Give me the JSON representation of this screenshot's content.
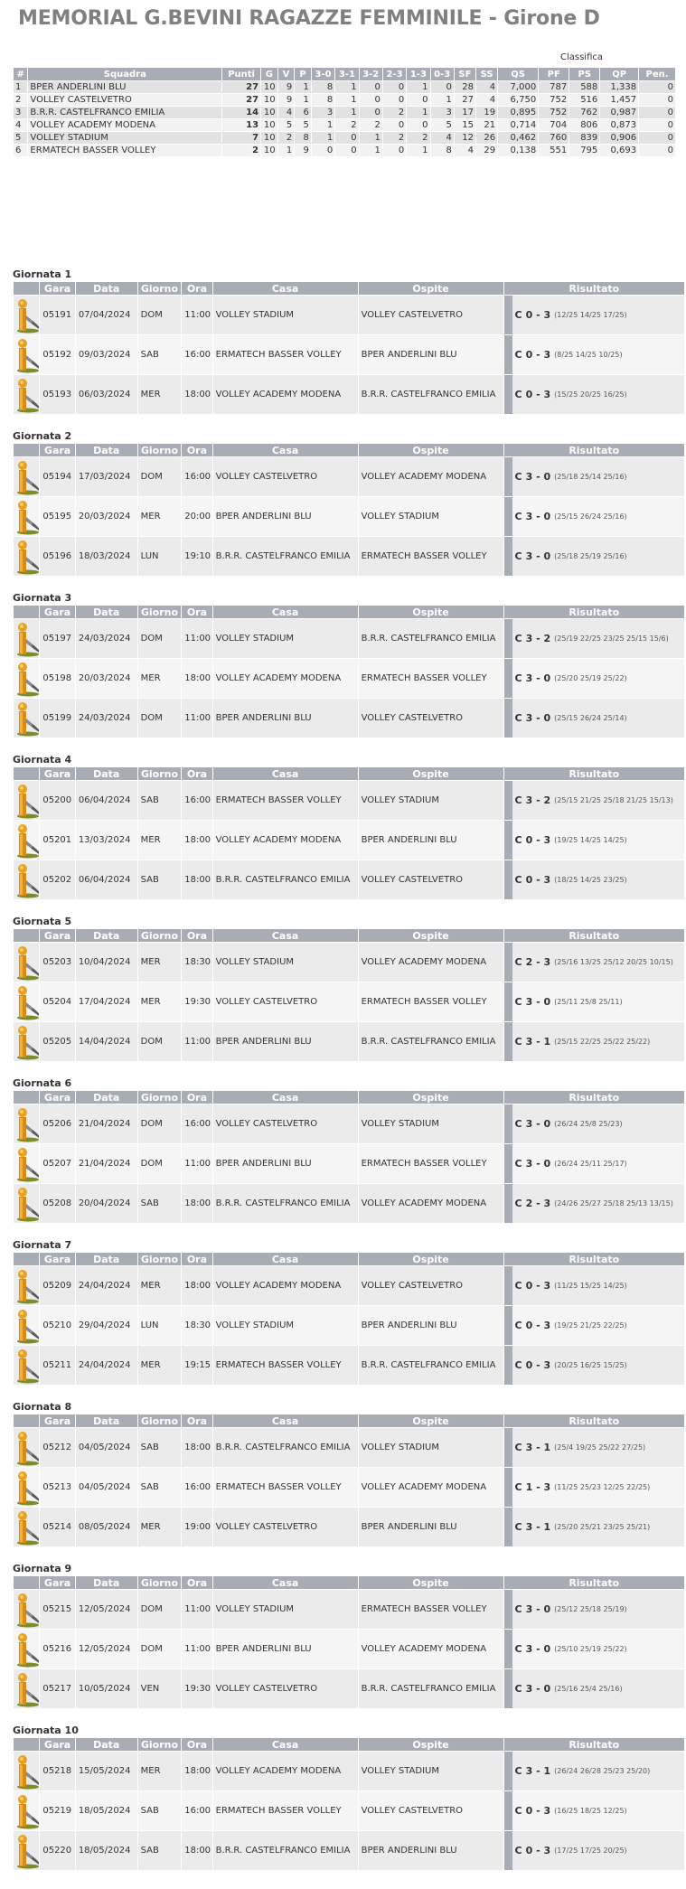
{
  "page": {
    "title": "MEMORIAL G.BEVINI RAGAZZE FEMMINILE - Girone D",
    "classifica_label": "Classifica"
  },
  "standings": {
    "headers": [
      "#",
      "Squadra",
      "Punti",
      "G",
      "V",
      "P",
      "3-0",
      "3-1",
      "3-2",
      "2-3",
      "1-3",
      "0-3",
      "SF",
      "SS",
      "QS",
      "PF",
      "PS",
      "QP",
      "Pen."
    ],
    "rows": [
      [
        "1",
        "BPER ANDERLINI BLU",
        "27",
        "10",
        "9",
        "1",
        "8",
        "1",
        "0",
        "0",
        "1",
        "0",
        "28",
        "4",
        "7,000",
        "787",
        "588",
        "1,338",
        "0"
      ],
      [
        "2",
        "VOLLEY CASTELVETRO",
        "27",
        "10",
        "9",
        "1",
        "8",
        "1",
        "0",
        "0",
        "0",
        "1",
        "27",
        "4",
        "6,750",
        "752",
        "516",
        "1,457",
        "0"
      ],
      [
        "3",
        "B.R.R. CASTELFRANCO EMILIA",
        "14",
        "10",
        "4",
        "6",
        "3",
        "1",
        "0",
        "2",
        "1",
        "3",
        "17",
        "19",
        "0,895",
        "752",
        "762",
        "0,987",
        "0"
      ],
      [
        "4",
        "VOLLEY ACADEMY MODENA",
        "13",
        "10",
        "5",
        "5",
        "1",
        "2",
        "2",
        "0",
        "0",
        "5",
        "15",
        "21",
        "0,714",
        "704",
        "806",
        "0,873",
        "0"
      ],
      [
        "5",
        "VOLLEY STADIUM",
        "7",
        "10",
        "2",
        "8",
        "1",
        "0",
        "1",
        "2",
        "2",
        "4",
        "12",
        "26",
        "0,462",
        "760",
        "839",
        "0,906",
        "0"
      ],
      [
        "6",
        "ERMATECH BASSER VOLLEY",
        "2",
        "10",
        "1",
        "9",
        "0",
        "0",
        "1",
        "0",
        "1",
        "8",
        "4",
        "29",
        "0,138",
        "551",
        "795",
        "0,693",
        "0"
      ]
    ]
  },
  "match_headers": [
    "",
    "Gara",
    "Data",
    "Giorno",
    "Ora",
    "Casa",
    "Ospite",
    "Risultato"
  ],
  "rounds": [
    {
      "title": "Giornata 1",
      "matches": [
        {
          "gara": "05191",
          "data": "07/04/2024",
          "giorno": "DOM",
          "ora": "11:00",
          "casa": "VOLLEY STADIUM",
          "ospite": "VOLLEY CASTELVETRO",
          "c": "C",
          "score": "0 - 3",
          "sets": "(12/25 14/25 17/25)"
        },
        {
          "gara": "05192",
          "data": "09/03/2024",
          "giorno": "SAB",
          "ora": "16:00",
          "casa": "ERMATECH BASSER VOLLEY",
          "ospite": "BPER ANDERLINI BLU",
          "c": "C",
          "score": "0 - 3",
          "sets": "(8/25 14/25 10/25)"
        },
        {
          "gara": "05193",
          "data": "06/03/2024",
          "giorno": "MER",
          "ora": "18:00",
          "casa": "VOLLEY ACADEMY MODENA",
          "ospite": "B.R.R. CASTELFRANCO EMILIA",
          "c": "C",
          "score": "0 - 3",
          "sets": "(15/25 20/25 16/25)"
        }
      ]
    },
    {
      "title": "Giornata 2",
      "matches": [
        {
          "gara": "05194",
          "data": "17/03/2024",
          "giorno": "DOM",
          "ora": "16:00",
          "casa": "VOLLEY CASTELVETRO",
          "ospite": "VOLLEY ACADEMY MODENA",
          "c": "C",
          "score": "3 - 0",
          "sets": "(25/18 25/14 25/16)"
        },
        {
          "gara": "05195",
          "data": "20/03/2024",
          "giorno": "MER",
          "ora": "20:00",
          "casa": "BPER ANDERLINI BLU",
          "ospite": "VOLLEY STADIUM",
          "c": "C",
          "score": "3 - 0",
          "sets": "(25/15 26/24 25/16)"
        },
        {
          "gara": "05196",
          "data": "18/03/2024",
          "giorno": "LUN",
          "ora": "19:10",
          "casa": "B.R.R. CASTELFRANCO EMILIA",
          "ospite": "ERMATECH BASSER VOLLEY",
          "c": "C",
          "score": "3 - 0",
          "sets": "(25/18 25/19 25/16)"
        }
      ]
    },
    {
      "title": "Giornata 3",
      "matches": [
        {
          "gara": "05197",
          "data": "24/03/2024",
          "giorno": "DOM",
          "ora": "11:00",
          "casa": "VOLLEY STADIUM",
          "ospite": "B.R.R. CASTELFRANCO EMILIA",
          "c": "C",
          "score": "3 - 2",
          "sets": "(25/19 22/25 23/25 25/15 15/6)"
        },
        {
          "gara": "05198",
          "data": "20/03/2024",
          "giorno": "MER",
          "ora": "18:00",
          "casa": "VOLLEY ACADEMY MODENA",
          "ospite": "ERMATECH BASSER VOLLEY",
          "c": "C",
          "score": "3 - 0",
          "sets": "(25/20 25/19 25/22)"
        },
        {
          "gara": "05199",
          "data": "24/03/2024",
          "giorno": "DOM",
          "ora": "11:00",
          "casa": "BPER ANDERLINI BLU",
          "ospite": "VOLLEY CASTELVETRO",
          "c": "C",
          "score": "3 - 0",
          "sets": "(25/15 26/24 25/14)"
        }
      ]
    },
    {
      "title": "Giornata 4",
      "matches": [
        {
          "gara": "05200",
          "data": "06/04/2024",
          "giorno": "SAB",
          "ora": "16:00",
          "casa": "ERMATECH BASSER VOLLEY",
          "ospite": "VOLLEY STADIUM",
          "c": "C",
          "score": "3 - 2",
          "sets": "(25/15 21/25 25/18 21/25 15/13)"
        },
        {
          "gara": "05201",
          "data": "13/03/2024",
          "giorno": "MER",
          "ora": "18:00",
          "casa": "VOLLEY ACADEMY MODENA",
          "ospite": "BPER ANDERLINI BLU",
          "c": "C",
          "score": "0 - 3",
          "sets": "(19/25 14/25 14/25)"
        },
        {
          "gara": "05202",
          "data": "06/04/2024",
          "giorno": "SAB",
          "ora": "18:00",
          "casa": "B.R.R. CASTELFRANCO EMILIA",
          "ospite": "VOLLEY CASTELVETRO",
          "c": "C",
          "score": "0 - 3",
          "sets": "(18/25 14/25 23/25)"
        }
      ]
    },
    {
      "title": "Giornata 5",
      "matches": [
        {
          "gara": "05203",
          "data": "10/04/2024",
          "giorno": "MER",
          "ora": "18:30",
          "casa": "VOLLEY STADIUM",
          "ospite": "VOLLEY ACADEMY MODENA",
          "c": "C",
          "score": "2 - 3",
          "sets": "(25/16 13/25 25/12 20/25 10/15)"
        },
        {
          "gara": "05204",
          "data": "17/04/2024",
          "giorno": "MER",
          "ora": "19:30",
          "casa": "VOLLEY CASTELVETRO",
          "ospite": "ERMATECH BASSER VOLLEY",
          "c": "C",
          "score": "3 - 0",
          "sets": "(25/11 25/8 25/11)"
        },
        {
          "gara": "05205",
          "data": "14/04/2024",
          "giorno": "DOM",
          "ora": "11:00",
          "casa": "BPER ANDERLINI BLU",
          "ospite": "B.R.R. CASTELFRANCO EMILIA",
          "c": "C",
          "score": "3 - 1",
          "sets": "(25/15 22/25 25/22 25/22)"
        }
      ]
    },
    {
      "title": "Giornata 6",
      "matches": [
        {
          "gara": "05206",
          "data": "21/04/2024",
          "giorno": "DOM",
          "ora": "16:00",
          "casa": "VOLLEY CASTELVETRO",
          "ospite": "VOLLEY STADIUM",
          "c": "C",
          "score": "3 - 0",
          "sets": "(26/24 25/8 25/23)"
        },
        {
          "gara": "05207",
          "data": "21/04/2024",
          "giorno": "DOM",
          "ora": "11:00",
          "casa": "BPER ANDERLINI BLU",
          "ospite": "ERMATECH BASSER VOLLEY",
          "c": "C",
          "score": "3 - 0",
          "sets": "(26/24 25/11 25/17)"
        },
        {
          "gara": "05208",
          "data": "20/04/2024",
          "giorno": "SAB",
          "ora": "18:00",
          "casa": "B.R.R. CASTELFRANCO EMILIA",
          "ospite": "VOLLEY ACADEMY MODENA",
          "c": "C",
          "score": "2 - 3",
          "sets": "(24/26 25/27 25/18 25/13 13/15)"
        }
      ]
    },
    {
      "title": "Giornata 7",
      "matches": [
        {
          "gara": "05209",
          "data": "24/04/2024",
          "giorno": "MER",
          "ora": "18:00",
          "casa": "VOLLEY ACADEMY MODENA",
          "ospite": "VOLLEY CASTELVETRO",
          "c": "C",
          "score": "0 - 3",
          "sets": "(11/25 15/25 14/25)"
        },
        {
          "gara": "05210",
          "data": "29/04/2024",
          "giorno": "LUN",
          "ora": "18:30",
          "casa": "VOLLEY STADIUM",
          "ospite": "BPER ANDERLINI BLU",
          "c": "C",
          "score": "0 - 3",
          "sets": "(19/25 21/25 22/25)"
        },
        {
          "gara": "05211",
          "data": "24/04/2024",
          "giorno": "MER",
          "ora": "19:15",
          "casa": "ERMATECH BASSER VOLLEY",
          "ospite": "B.R.R. CASTELFRANCO EMILIA",
          "c": "C",
          "score": "0 - 3",
          "sets": "(20/25 16/25 15/25)"
        }
      ]
    },
    {
      "title": "Giornata 8",
      "matches": [
        {
          "gara": "05212",
          "data": "04/05/2024",
          "giorno": "SAB",
          "ora": "18:00",
          "casa": "B.R.R. CASTELFRANCO EMILIA",
          "ospite": "VOLLEY STADIUM",
          "c": "C",
          "score": "3 - 1",
          "sets": "(25/4 19/25 25/22 27/25)"
        },
        {
          "gara": "05213",
          "data": "04/05/2024",
          "giorno": "SAB",
          "ora": "16:00",
          "casa": "ERMATECH BASSER VOLLEY",
          "ospite": "VOLLEY ACADEMY MODENA",
          "c": "C",
          "score": "1 - 3",
          "sets": "(11/25 25/23 12/25 22/25)"
        },
        {
          "gara": "05214",
          "data": "08/05/2024",
          "giorno": "MER",
          "ora": "19:00",
          "casa": "VOLLEY CASTELVETRO",
          "ospite": "BPER ANDERLINI BLU",
          "c": "C",
          "score": "3 - 1",
          "sets": "(25/20 25/21 23/25 25/21)"
        }
      ]
    },
    {
      "title": "Giornata 9",
      "matches": [
        {
          "gara": "05215",
          "data": "12/05/2024",
          "giorno": "DOM",
          "ora": "11:00",
          "casa": "VOLLEY STADIUM",
          "ospite": "ERMATECH BASSER VOLLEY",
          "c": "C",
          "score": "3 - 0",
          "sets": "(25/12 25/18 25/19)"
        },
        {
          "gara": "05216",
          "data": "12/05/2024",
          "giorno": "DOM",
          "ora": "11:00",
          "casa": "BPER ANDERLINI BLU",
          "ospite": "VOLLEY ACADEMY MODENA",
          "c": "C",
          "score": "3 - 0",
          "sets": "(25/10 25/19 25/22)"
        },
        {
          "gara": "05217",
          "data": "10/05/2024",
          "giorno": "VEN",
          "ora": "19:30",
          "casa": "VOLLEY CASTELVETRO",
          "ospite": "B.R.R. CASTELFRANCO EMILIA",
          "c": "C",
          "score": "3 - 0",
          "sets": "(25/16 25/4 25/16)"
        }
      ]
    },
    {
      "title": "Giornata 10",
      "matches": [
        {
          "gara": "05218",
          "data": "15/05/2024",
          "giorno": "MER",
          "ora": "18:00",
          "casa": "VOLLEY ACADEMY MODENA",
          "ospite": "VOLLEY STADIUM",
          "c": "C",
          "score": "3 - 1",
          "sets": "(26/24 26/28 25/23 25/20)"
        },
        {
          "gara": "05219",
          "data": "18/05/2024",
          "giorno": "SAB",
          "ora": "16:00",
          "casa": "ERMATECH BASSER VOLLEY",
          "ospite": "VOLLEY CASTELVETRO",
          "c": "C",
          "score": "0 - 3",
          "sets": "(16/25 18/25 12/25)"
        },
        {
          "gara": "05220",
          "data": "18/05/2024",
          "giorno": "SAB",
          "ora": "18:00",
          "casa": "B.R.R. CASTELFRANCO EMILIA",
          "ospite": "BPER ANDERLINI BLU",
          "c": "C",
          "score": "0 - 3",
          "sets": "(17/25 17/25 20/25)"
        }
      ]
    }
  ],
  "icons": {
    "referee": "referee-icon"
  },
  "colors": {
    "header_bg": "#a8adb5",
    "row_odd": "#ebebeb",
    "row_even": "#f5f5f5",
    "title": "#808080"
  }
}
